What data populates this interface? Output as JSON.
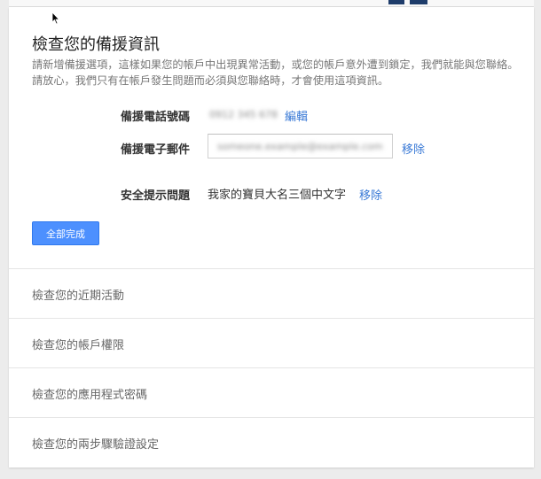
{
  "section": {
    "title": "檢查您的備援資訊",
    "description": "請新增備援選項，這樣如果您的帳戶中出現異常活動，或您的帳戶意外遭到鎖定，我們就能與您聯絡。請放心，我們只有在帳戶發生問題而必須與您聯絡時，才會使用這項資訊。"
  },
  "phone": {
    "label": "備援電話號碼",
    "value": "0912 345 678",
    "action": "編輯"
  },
  "email": {
    "label": "備援電子郵件",
    "value": "someone.example@example.com",
    "action": "移除"
  },
  "security_question": {
    "label": "安全提示問題",
    "answer": "我家的寶貝大名三個中文字",
    "action": "移除"
  },
  "done_button": "全部完成",
  "review_items": [
    {
      "label": "檢查您的近期活動"
    },
    {
      "label": "檢查您的帳戶權限"
    },
    {
      "label": "檢查您的應用程式密碼"
    },
    {
      "label": "檢查您的兩步驟驗證設定"
    }
  ],
  "colors": {
    "link": "#3a7ad6",
    "button": "#4d90fe",
    "background": "#ececec"
  }
}
